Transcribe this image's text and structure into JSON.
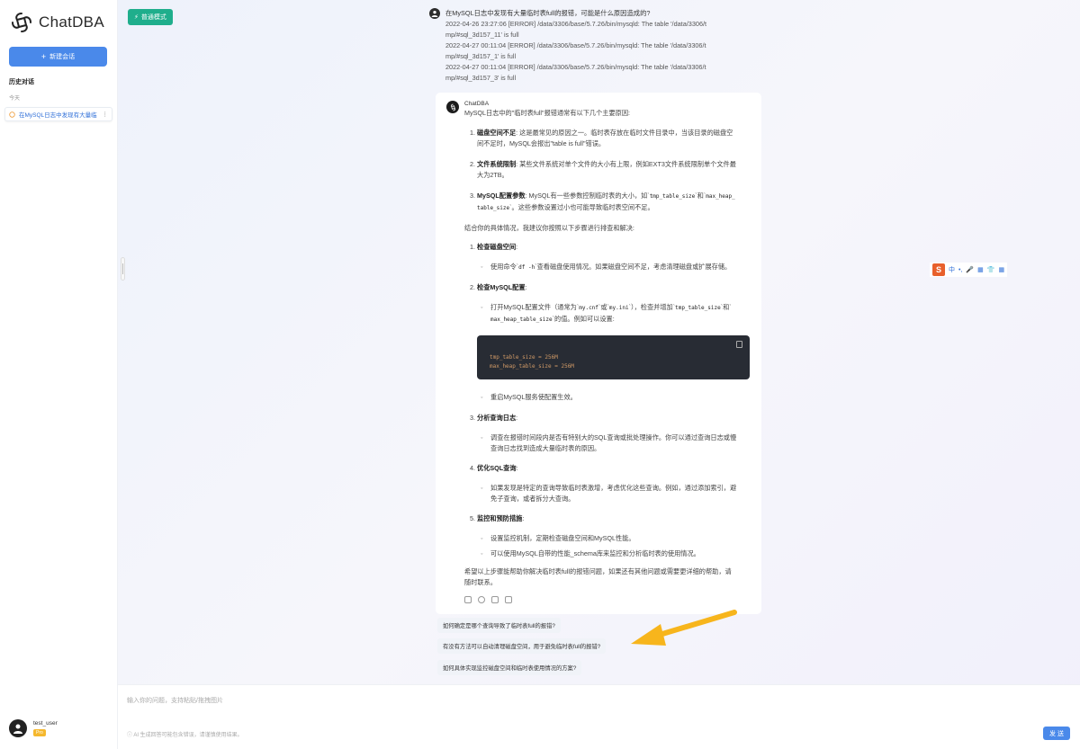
{
  "sidebar": {
    "brand": "ChatDBA",
    "new_chat": "新建会话",
    "history_title": "历史对话",
    "today": "今天",
    "items": [
      {
        "label": "在MySQL日志中发现有大量临"
      }
    ]
  },
  "user": {
    "name": "test_user",
    "badge": "Pro"
  },
  "toolbar": {
    "mode": "普通模式"
  },
  "user_message": {
    "question": "在MySQL日志中发现有大量临时表full的报错，可能是什么原因造成的?",
    "logs": [
      "2022-04-26 23:27:06 [ERROR] /data/3306/base/5.7.26/bin/mysqld: The table '/data/3306/t",
      "mp/#sql_3d157_11' is full",
      "2022-04-27 00:11:04 [ERROR] /data/3306/base/5.7.26/bin/mysqld: The table '/data/3306/t",
      "mp/#sql_3d157_1' is full",
      "2022-04-27 00:11:04 [ERROR] /data/3306/base/5.7.26/bin/mysqld: The table '/data/3306/t",
      "mp/#sql_3d157_3' is full"
    ]
  },
  "bot": {
    "name": "ChatDBA",
    "intro": "MySQL日志中的\"临时表full\"报错通常有以下几个主要原因:",
    "causes": [
      {
        "n": "1.",
        "title": "磁盘空间不足",
        "text": ": 这是最常见的原因之一。临时表存放在临时文件目录中，当该目录的磁盘空",
        "text2": "间不足时，MySQL会报出\"table is full\"错误。"
      },
      {
        "n": "2.",
        "title": "文件系统限制",
        "text": ": 某些文件系统对单个文件的大小有上限，例如EXT3文件系统限制单个文件最",
        "text2": "大为2TB。"
      },
      {
        "n": "3.",
        "title": "MySQL配置参数",
        "text": ": MySQL有一些参数控制临时表的大小，如`",
        "code1": "tmp_table_size",
        "mid": "`和`",
        "code2": "max_heap_",
        "text2a": "table_size",
        "text2": "`。这些参数设置过小也可能导致临时表空间不足。"
      }
    ],
    "steps_intro": "结合你的具体情况，我建议你按照以下步骤进行排查和解决:",
    "s1_title": "检查磁盘空间",
    "s1_b1a": "使用命令`",
    "s1_code": "df -h",
    "s1_b1b": "`查看磁盘使用情况。如果磁盘空间不足，考虑清理磁盘或扩展存储。",
    "s2_title": "检查MySQL配置",
    "s2_b1a": "打开MySQL配置文件（通常为`",
    "s2_c1": "my.cnf",
    "s2_b1b": "`或`",
    "s2_c2": "my.ini",
    "s2_b1c": "`），检查并增加`",
    "s2_c3": "tmp_table_size",
    "s2_b1d": "`和`",
    "s2_c4": "max_heap_table_size",
    "s2_b1e": "`的值。例如可以设置:",
    "code_lines": [
      "tmp_table_size = 256M",
      "max_heap_table_size = 256M"
    ],
    "s2_b2": "重启MySQL服务使配置生效。",
    "s3_title": "分析查询日志",
    "s3_b1": "调查在报错时间段内是否有特别大的SQL查询或批处理操作。你可以通过查询日志或慢",
    "s3_b1b": "查询日志找到造成大量临时表的原因。",
    "s4_title": "优化SQL查询",
    "s4_b1": "如果发现是特定的查询导致临时表激增，考虑优化这些查询。例如，通过添加索引，避",
    "s4_b1b": "免子查询，或者拆分大查询。",
    "s5_title": "监控和预防措施",
    "s5_b1": "设置监控机制，定期检查磁盘空间和MySQL性能。",
    "s5_b2": "可以使用MySQL自带的性能_schema库来监控和分析临时表的使用情况。",
    "outro": "希望以上步骤能帮助你解决临时表full的报错问题，如果还有其他问题或需要更详细的帮助，请",
    "outro2": "随时联系。"
  },
  "suggestions": [
    "如何确定是哪个查询导致了临时表full的报错?",
    "有没有方法可以自动清理磁盘空间，用于避免临时表full的报错?",
    "如何具体实现监控磁盘空间和临时表使用情况的方案?"
  ],
  "input": {
    "placeholder": "输入你的问题，支持粘贴/拖拽图片",
    "disclaimer": "AI 生成回答可能包含错误，请谨慎使用结果。",
    "send": "发 送"
  },
  "ime": {
    "lang": "中"
  },
  "colors": {
    "accent": "#4a89ea",
    "mode": "#1fae8c",
    "arrow": "#f7b51c"
  }
}
